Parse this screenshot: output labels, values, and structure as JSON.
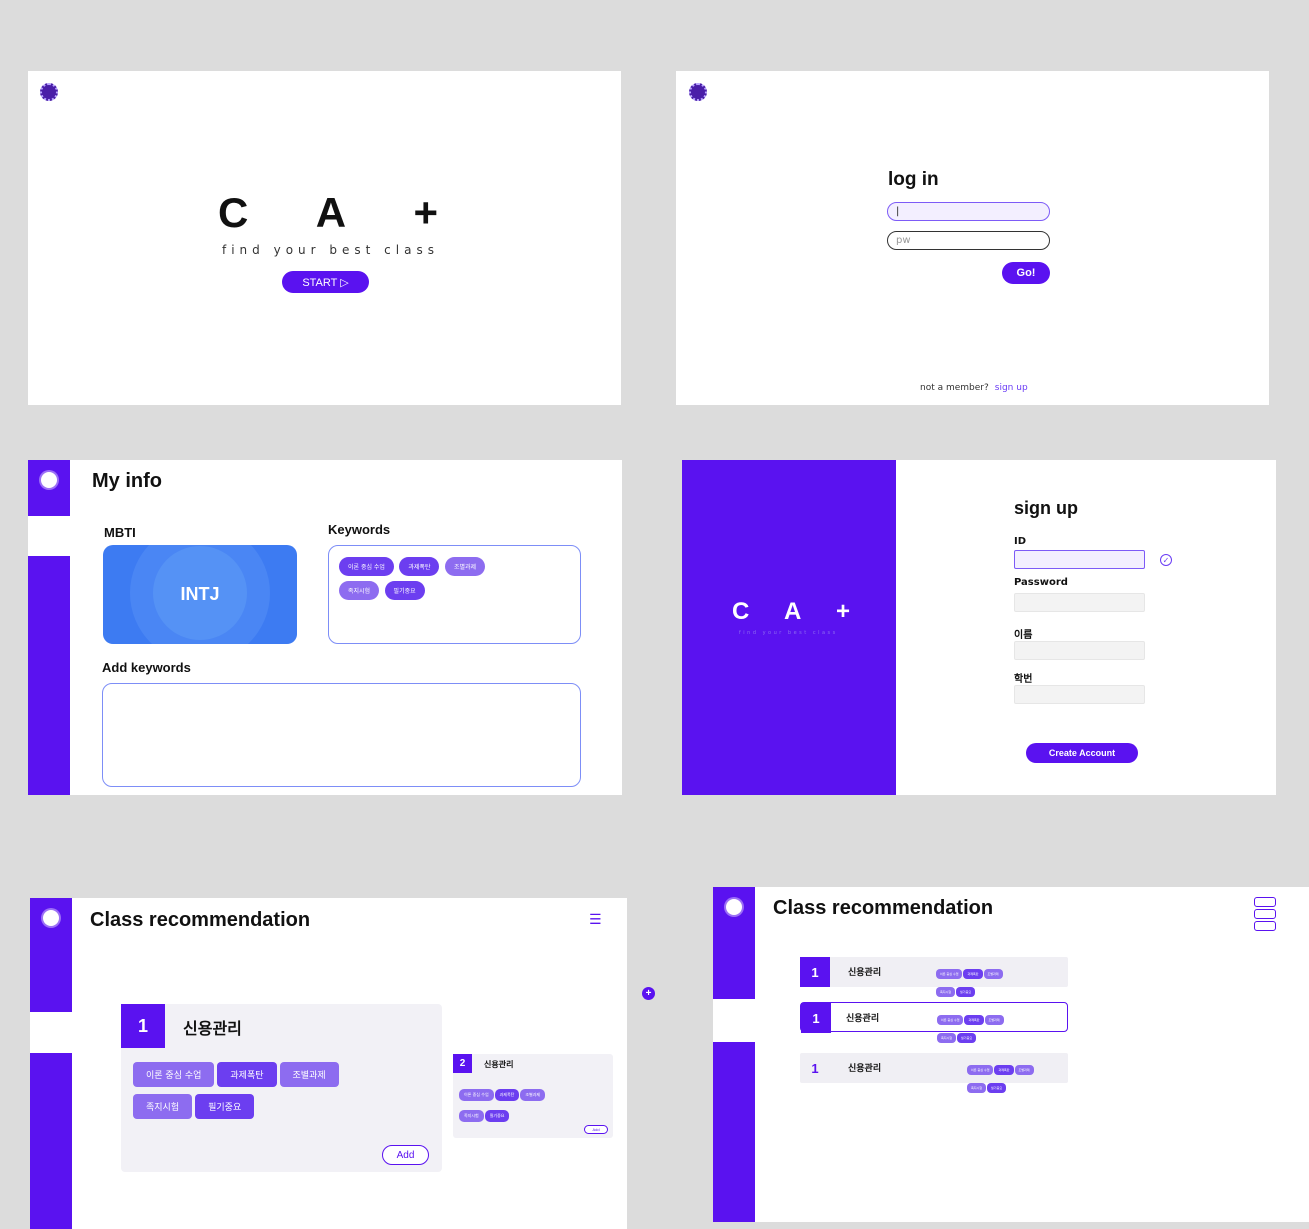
{
  "splash": {
    "logo": [
      "C",
      "A",
      "+"
    ],
    "tagline": "find your best class",
    "start_label": "START ▷"
  },
  "login": {
    "title": "log in",
    "id_value": "|",
    "pw_placeholder": "pw",
    "go_label": "Go!",
    "footer_text": "not a member?",
    "signup_link": "sign up"
  },
  "myinfo": {
    "title": "My info",
    "mbti_label": "MBTI",
    "mbti_value": "INTJ",
    "keywords_label": "Keywords",
    "keywords": [
      "이론 중심 수업",
      "과제폭탄",
      "조별과제",
      "족지시험",
      "필기중요"
    ],
    "add_keywords_label": "Add keywords"
  },
  "signup": {
    "logo": [
      "C",
      "A",
      "+"
    ],
    "tagline": "find your best class",
    "title": "sign up",
    "fields": [
      "ID",
      "Password",
      "이름",
      "학번"
    ],
    "create_label": "Create Account"
  },
  "classrec": {
    "title": "Class recommendation",
    "card": {
      "rank": "1",
      "name": "신용관리",
      "tags": [
        "이론 중심 수업",
        "과제폭탄",
        "조별과제",
        "족지시험",
        "필기중요"
      ],
      "add_label": "Add"
    },
    "mini": {
      "rank": "2",
      "name": "신용관리",
      "tags": [
        "이론 중심 수업",
        "과제폭탄",
        "조별과제",
        "족지시험",
        "필기중요"
      ],
      "add_label": "Add"
    }
  },
  "classlist": {
    "title": "Class recommendation",
    "rows": [
      {
        "rank": "1",
        "name": "신용관리"
      },
      {
        "rank": "1",
        "name": "신용관리"
      },
      {
        "rank": "1",
        "name": "신용관리"
      }
    ]
  },
  "colors": {
    "accent": "#5a12f0",
    "mbti_card": "#3d7bf2"
  }
}
